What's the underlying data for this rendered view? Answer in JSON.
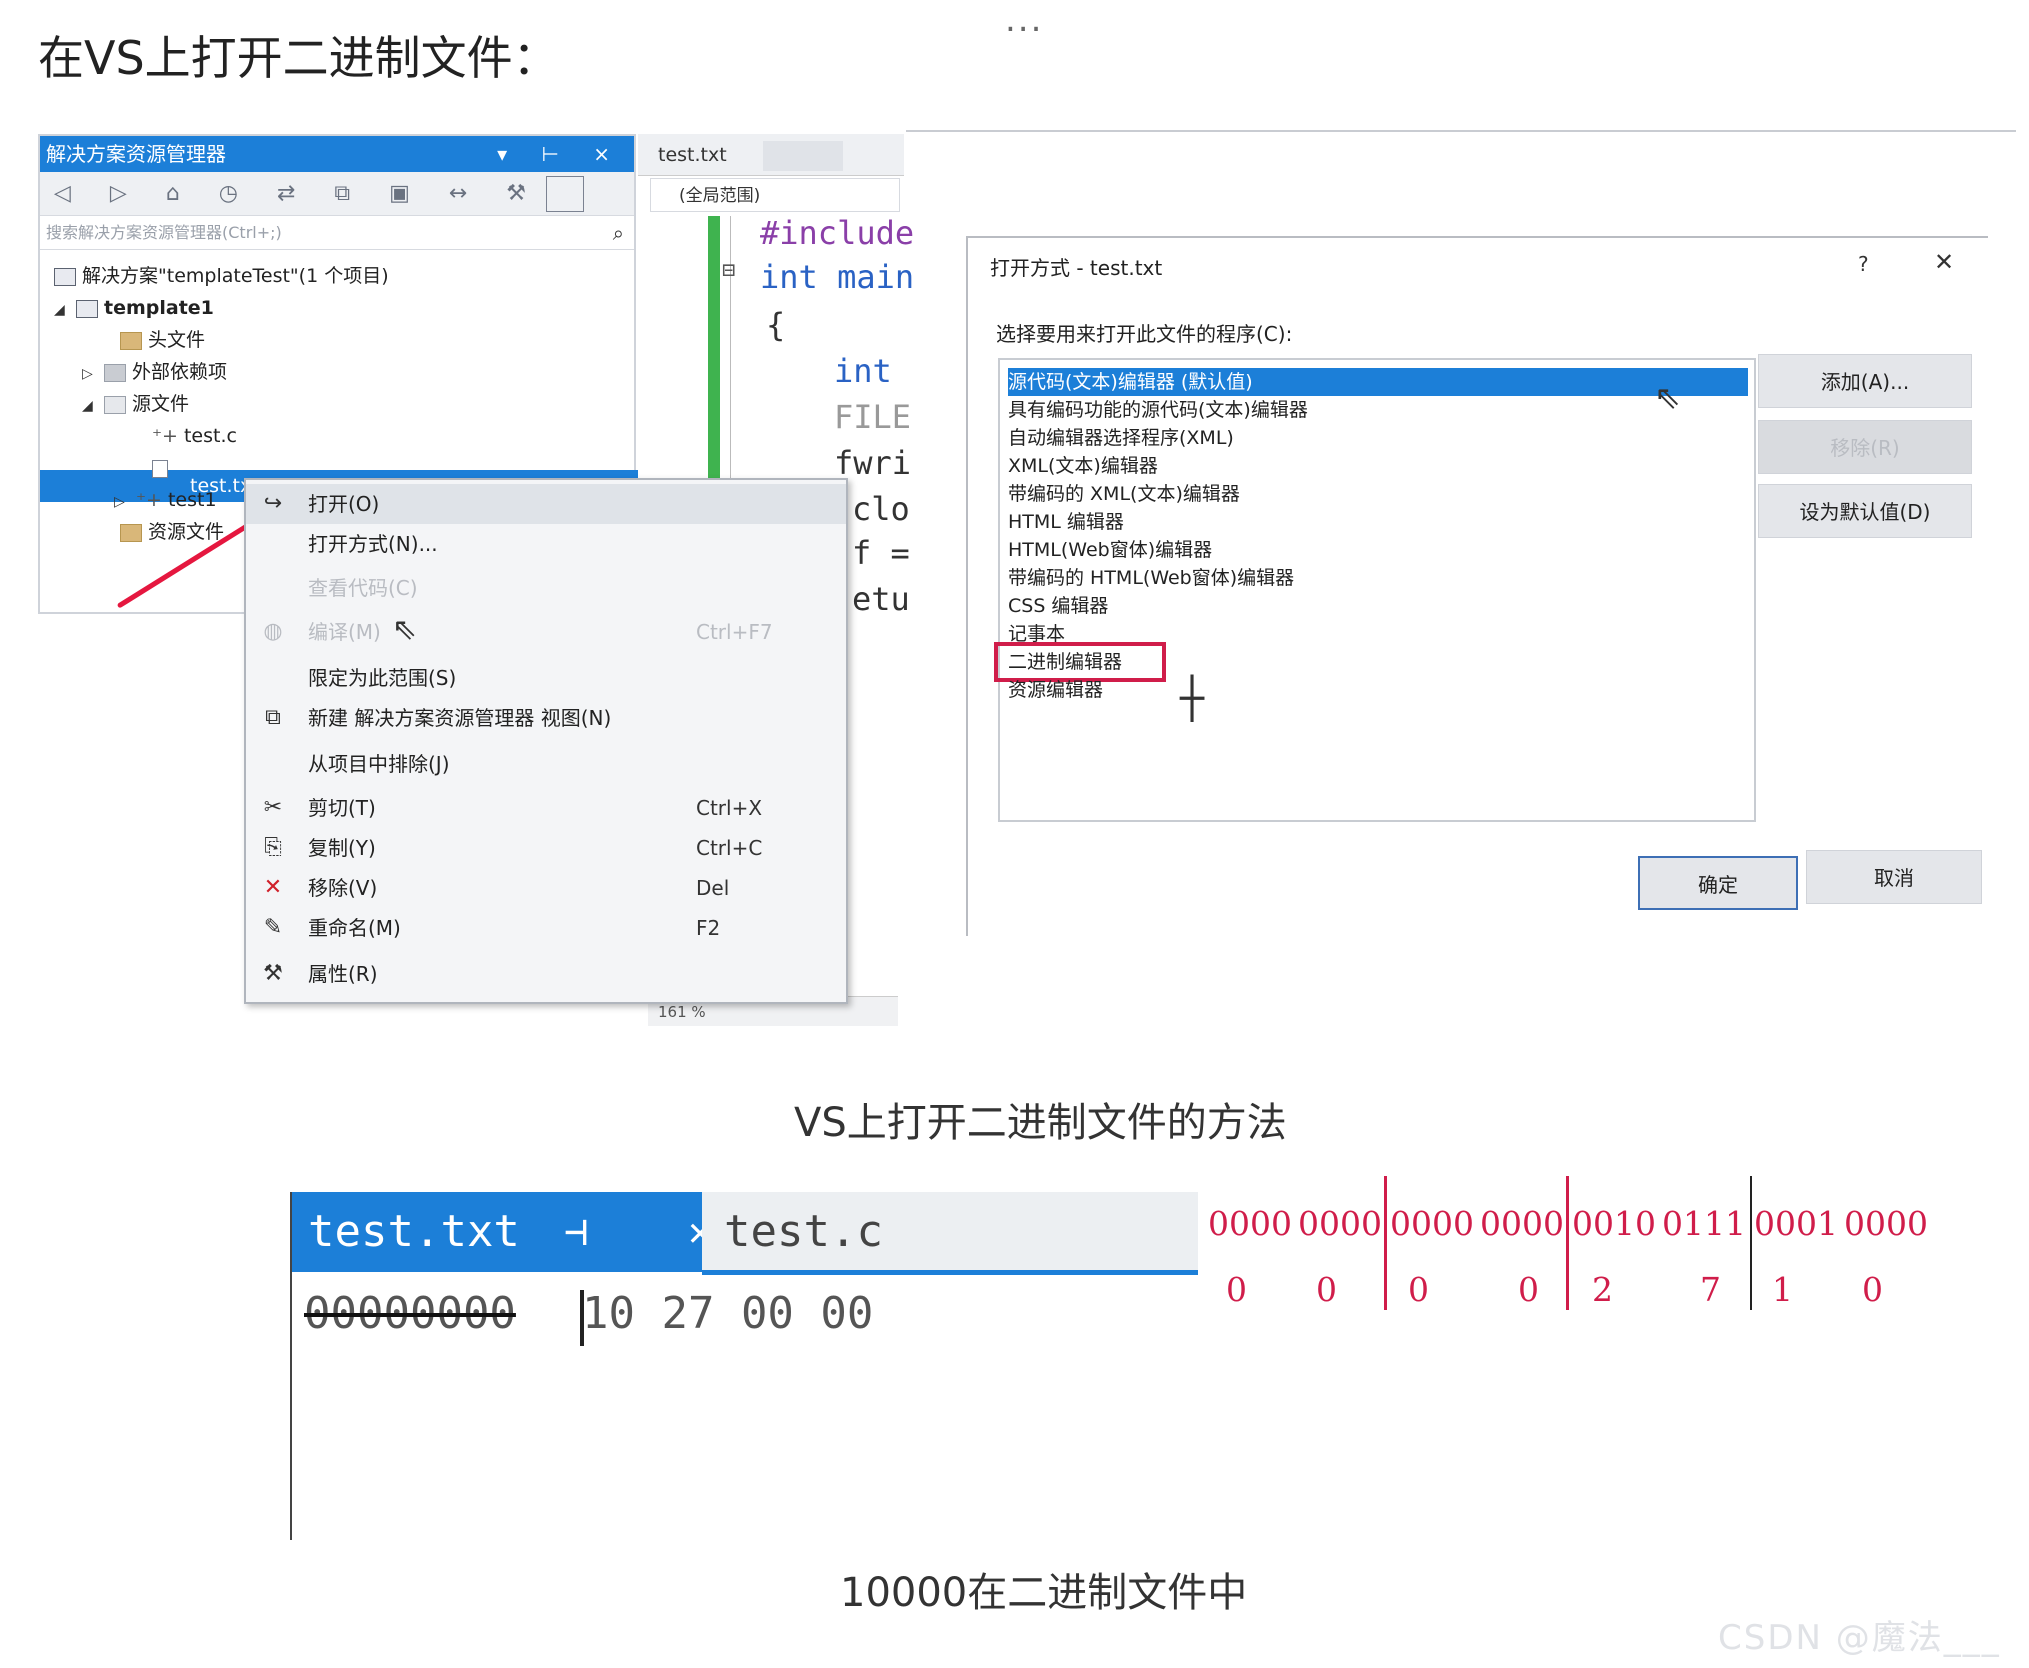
{
  "page": {
    "heading": "在VS上打开二进制文件：",
    "dots": "...",
    "caption1": "VS上打开二进制文件的方法",
    "caption2": "10000在二进制文件中",
    "watermark": "CSDN @魔法___王哥"
  },
  "solution_explorer": {
    "title": "解决方案资源管理器",
    "controls": "▾ ⊢ ×",
    "toolbar_icons": "◁ ▷ ⌂ ◷ ⇄ ⧉ ▣ ↔ ⚒",
    "search_placeholder": "搜索解决方案资源管理器(Ctrl+;)",
    "tree": [
      {
        "label": "解决方案\"templateTest\"(1 个项目)"
      },
      {
        "label": "template1"
      },
      {
        "label": "头文件"
      },
      {
        "label": "外部依赖项"
      },
      {
        "label": "源文件"
      },
      {
        "label": "test.c"
      },
      {
        "label": "test.txt"
      },
      {
        "label": "test1"
      },
      {
        "label": "资源文件"
      }
    ]
  },
  "editor": {
    "tab": "test.txt",
    "scope": "(全局范围)",
    "zoom": "161 %",
    "code": [
      "#include",
      "int main",
      "{",
      "int",
      "FILE",
      "fwri",
      "clo",
      "f =",
      "etu"
    ]
  },
  "context_menu": {
    "items": [
      {
        "icon": "↪",
        "label": "打开(O)",
        "key": ""
      },
      {
        "icon": "",
        "label": "打开方式(N)...",
        "key": ""
      },
      {
        "icon": "",
        "label": "查看代码(C)",
        "key": ""
      },
      {
        "icon": "",
        "label": "编译(M)",
        "key": "Ctrl+F7"
      },
      {
        "icon": "",
        "label": "限定为此范围(S)",
        "key": ""
      },
      {
        "icon": "⧉",
        "label": "新建 解决方案资源管理器 视图(N)",
        "key": ""
      },
      {
        "icon": "",
        "label": "从项目中排除(J)",
        "key": ""
      },
      {
        "icon": "✂",
        "label": "剪切(T)",
        "key": "Ctrl+X"
      },
      {
        "icon": "⎘",
        "label": "复制(Y)",
        "key": "Ctrl+C"
      },
      {
        "icon": "✕",
        "label": "移除(V)",
        "key": "Del"
      },
      {
        "icon": "✎",
        "label": "重命名(M)",
        "key": "F2"
      },
      {
        "icon": "⚒",
        "label": "属性(R)",
        "key": ""
      }
    ]
  },
  "open_with_dialog": {
    "title": "打开方式 - test.txt",
    "help": "?",
    "close": "✕",
    "prompt": "选择要用来打开此文件的程序(C):",
    "programs": [
      "源代码(文本)编辑器 (默认值)",
      "具有编码功能的源代码(文本)编辑器",
      "自动编辑器选择程序(XML)",
      "XML(文本)编辑器",
      "带编码的 XML(文本)编辑器",
      "HTML 编辑器",
      "HTML(Web窗体)编辑器",
      "带编码的 HTML(Web窗体)编辑器",
      "CSS 编辑器",
      "记事本",
      "二进制编辑器",
      "资源编辑器"
    ],
    "buttons": {
      "add": "添加(A)...",
      "remove": "移除(R)",
      "set_default": "设为默认值(D)",
      "ok": "确定",
      "cancel": "取消"
    }
  },
  "binary_editor": {
    "active_tab": "test.txt",
    "tab_controls": "⊣ ✕",
    "other_tab": "test.c",
    "address": "00000000",
    "bytes": "10 27 00 00"
  },
  "bit_annotation": {
    "nibbles": [
      "0000",
      "0000",
      "0000",
      "0000",
      "0010",
      "0111",
      "0001",
      "0000"
    ],
    "hex_digits": [
      "0",
      "0",
      "0",
      "0",
      "2",
      "7",
      "1",
      "0"
    ]
  },
  "colors": {
    "accent_blue": "#1c7fd8",
    "annotation_red": "#d01d4a",
    "line_green": "#3fb34f"
  }
}
